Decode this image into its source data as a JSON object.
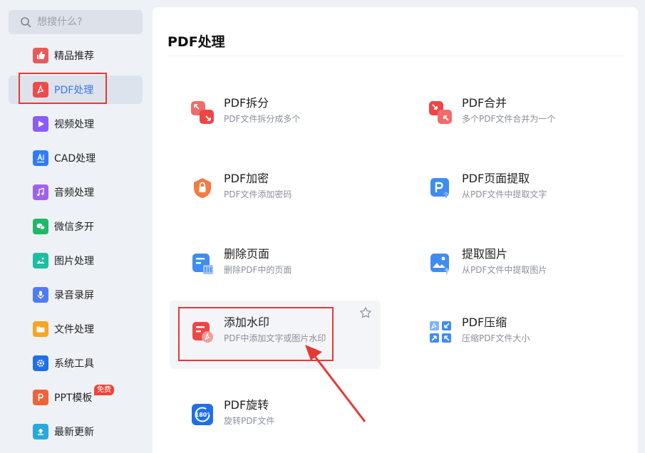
{
  "search": {
    "placeholder": "想搜什么?"
  },
  "sidebar": {
    "items": [
      {
        "label": "精品推荐",
        "icon": "thumbs-up-icon",
        "color": "#e85a5a"
      },
      {
        "label": "PDF处理",
        "icon": "pdf-icon",
        "color": "#ef4b4b"
      },
      {
        "label": "视频处理",
        "icon": "video-play-icon",
        "color": "#8b5cf6"
      },
      {
        "label": "CAD处理",
        "icon": "cad-icon",
        "color": "#2f7cf6"
      },
      {
        "label": "音频处理",
        "icon": "music-note-icon",
        "color": "#a061f2"
      },
      {
        "label": "微信多开",
        "icon": "wechat-icon",
        "color": "#1fb866"
      },
      {
        "label": "图片处理",
        "icon": "image-icon",
        "color": "#1bbfa0"
      },
      {
        "label": "录音录屏",
        "icon": "microphone-icon",
        "color": "#4f7cf6"
      },
      {
        "label": "文件处理",
        "icon": "folder-icon",
        "color": "#f5a623"
      },
      {
        "label": "系统工具",
        "icon": "gear-icon",
        "color": "#1f6fe8"
      },
      {
        "label": "PPT模板",
        "icon": "ppt-icon",
        "color": "#f0633a",
        "badge": "免费"
      },
      {
        "label": "最新更新",
        "icon": "upload-icon",
        "color": "#29a8e0"
      }
    ]
  },
  "main": {
    "title": "PDF处理",
    "tools": [
      {
        "name": "PDF拆分",
        "desc": "PDF文件拆分成多个",
        "icon": "split-icon"
      },
      {
        "name": "PDF合并",
        "desc": "多个PDF文件合并为一个",
        "icon": "merge-icon"
      },
      {
        "name": "PDF加密",
        "desc": "PDF文件添加密码",
        "icon": "lock-icon"
      },
      {
        "name": "PDF页面提取",
        "desc": "从PDF文件中提取文字",
        "icon": "page-extract-icon"
      },
      {
        "name": "删除页面",
        "desc": "删除PDF中的页面",
        "icon": "delete-page-icon"
      },
      {
        "name": "提取图片",
        "desc": "从PDF文件中提取图片",
        "icon": "extract-image-icon"
      },
      {
        "name": "添加水印",
        "desc": "PDF中添加文字或图片水印",
        "icon": "watermark-icon"
      },
      {
        "name": "PDF压缩",
        "desc": "压缩PDF文件大小",
        "icon": "compress-icon"
      },
      {
        "name": "PDF旋转",
        "desc": "旋转PDF文件",
        "icon": "rotate-icon"
      }
    ]
  }
}
